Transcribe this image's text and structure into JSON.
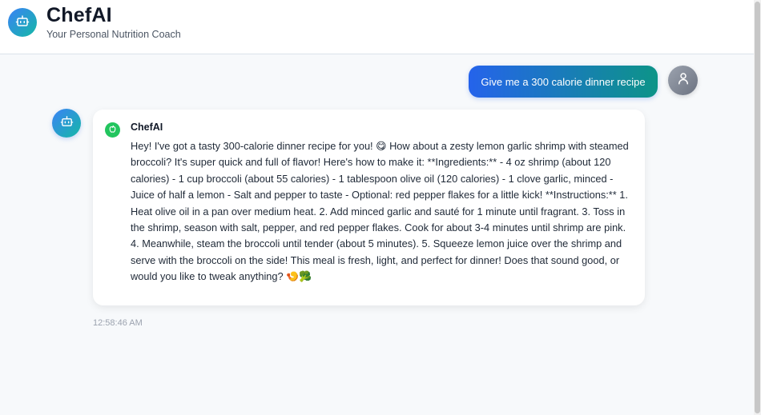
{
  "header": {
    "title": "ChefAI",
    "subtitle": "Your Personal Nutrition Coach"
  },
  "user_message": {
    "text": "Give me a 300 calorie dinner recipe"
  },
  "bot_message": {
    "sender": "ChefAI",
    "text": "Hey! I've got a tasty 300-calorie dinner recipe for you! 😋 How about a zesty lemon garlic shrimp with steamed broccoli? It's super quick and full of flavor! Here's how to make it: **Ingredients:** - 4 oz shrimp (about 120 calories) - 1 cup broccoli (about 55 calories) - 1 tablespoon olive oil (120 calories) - 1 clove garlic, minced - Juice of half a lemon - Salt and pepper to taste - Optional: red pepper flakes for a little kick! **Instructions:** 1. Heat olive oil in a pan over medium heat. 2. Add minced garlic and sauté for 1 minute until fragrant. 3. Toss in the shrimp, season with salt, pepper, and red pepper flakes. Cook for about 3-4 minutes until shrimp are pink. 4. Meanwhile, steam the broccoli until tender (about 5 minutes). 5. Squeeze lemon juice over the shrimp and serve with the broccoli on the side! This meal is fresh, light, and perfect for dinner! Does that sound good, or would you like to tweak anything? 🍤🥦",
    "timestamp": "12:58:46 AM"
  },
  "icons": {
    "logo": "robot-icon",
    "user_avatar": "user-icon",
    "bot_avatar": "robot-icon",
    "chef_badge": "apple-icon"
  },
  "colors": {
    "accent_start": "#2563eb",
    "accent_end": "#0d9488",
    "badge": "#22c55e"
  }
}
